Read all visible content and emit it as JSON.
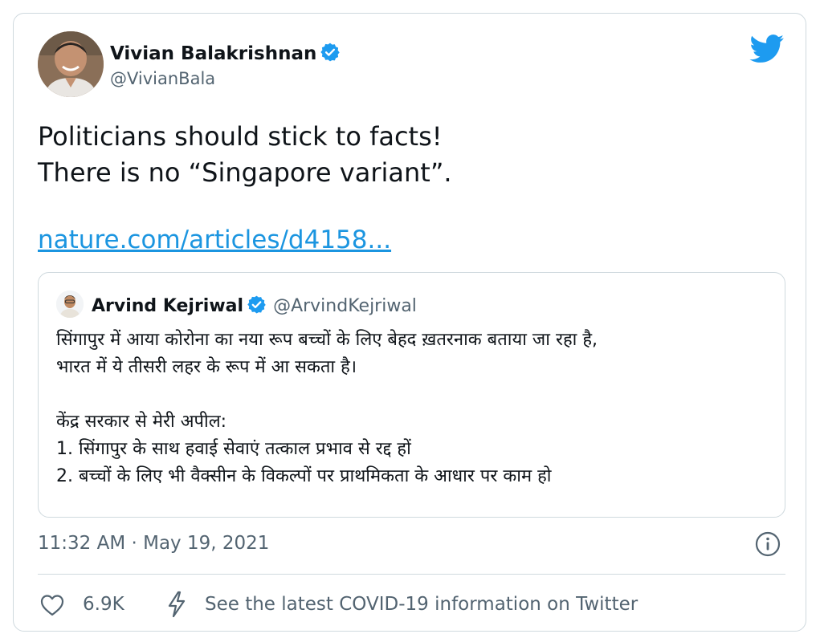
{
  "author": {
    "name": "Vivian Balakrishnan",
    "handle": "@VivianBala",
    "verified": true
  },
  "tweet": {
    "lines": [
      "Politicians should stick to facts!",
      "There is no “Singapore variant”."
    ],
    "link_text": "nature.com/articles/d4158..."
  },
  "quoted": {
    "name": "Arvind Kejriwal",
    "handle": "@ArvindKejriwal",
    "verified": true,
    "lines": [
      "सिंगापुर में आया कोरोना का नया रूप बच्चों के लिए बेहद ख़तरनाक बताया जा रहा है,",
      "भारत में ये तीसरी लहर के रूप में आ सकता है।",
      "",
      "केंद्र सरकार से मेरी अपील:",
      "1. सिंगापुर के साथ हवाई सेवाएं तत्काल प्रभाव से रद्द हों",
      "2. बच्चों के लिए भी वैक्सीन के विकल्पों पर प्राथमिकता के आधार पर काम हो"
    ]
  },
  "meta": {
    "timestamp": "11:32 AM · May 19, 2021"
  },
  "footer": {
    "like_count": "6.9K",
    "covid_text": "See the latest COVID-19 information on Twitter"
  },
  "icons": {
    "logo": "twitter-bird-icon",
    "verified": "verified-badge-icon",
    "info": "info-icon",
    "like": "heart-icon",
    "covid": "lightning-bolt-icon"
  },
  "colors": {
    "brand": "#1d9bf0",
    "link": "#1b95e0",
    "secondary_text": "#536471",
    "border": "#cfd9de"
  }
}
